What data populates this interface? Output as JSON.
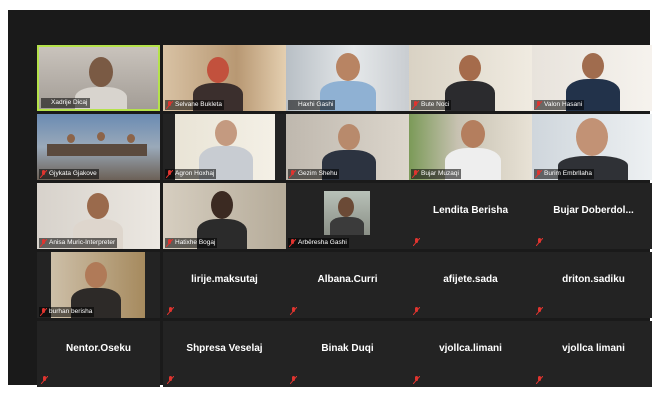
{
  "participants": [
    {
      "name": "Xadrije Dicaj",
      "video": true,
      "active": true,
      "muted": false
    },
    {
      "name": "Selvane Bukleta",
      "video": true,
      "muted": true
    },
    {
      "name": "Haxhi Gashi",
      "video": true,
      "muted": false
    },
    {
      "name": "Bute Noci",
      "video": true,
      "muted": true
    },
    {
      "name": "Valon Hasani",
      "video": true,
      "muted": true
    },
    {
      "name": "Gjykata Gjakove",
      "video": true,
      "muted": true
    },
    {
      "name": "Agron Hoxhaj",
      "video": true,
      "muted": true
    },
    {
      "name": "Gezim Shehu",
      "video": true,
      "muted": true
    },
    {
      "name": "Bujar Muzaqi",
      "video": true,
      "muted": true
    },
    {
      "name": "Burim Embrllaha",
      "video": true,
      "muted": true
    },
    {
      "name": "Anisa Muric-Interpreter",
      "video": true,
      "muted": true
    },
    {
      "name": "Hatixhe Bogaj",
      "video": true,
      "muted": true
    },
    {
      "name": "Arbëresha Gashi",
      "video": true,
      "muted": true
    },
    {
      "name": "Lendita Berisha",
      "video": false,
      "muted": true
    },
    {
      "name": "Bujar Doberdol...",
      "video": false,
      "muted": true
    },
    {
      "name": "burhan berisha",
      "video": true,
      "muted": true
    },
    {
      "name": "lirije.maksutaj",
      "video": false,
      "muted": true
    },
    {
      "name": "Albana.Curri",
      "video": false,
      "muted": true
    },
    {
      "name": "afijete.sada",
      "video": false,
      "muted": true
    },
    {
      "name": "driton.sadiku",
      "video": false,
      "muted": true
    },
    {
      "name": "Nentor.Oseku",
      "video": false,
      "muted": true
    },
    {
      "name": "Shpresa Veselaj",
      "video": false,
      "muted": true
    },
    {
      "name": "Binak Duqi",
      "video": false,
      "muted": true
    },
    {
      "name": "vjollca.limani",
      "video": false,
      "muted": true
    },
    {
      "name": "vjollca limani",
      "video": false,
      "muted": true
    }
  ],
  "colors": {
    "active_border": "#b5e24b",
    "mute_icon": "#e0342f",
    "tile_bg": "#232323"
  }
}
